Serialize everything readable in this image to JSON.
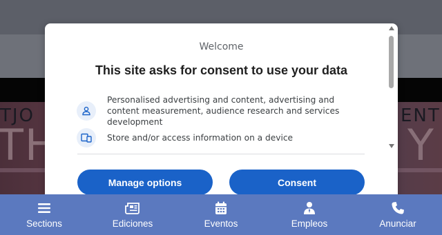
{
  "background": {
    "hero_left_small": "TJO",
    "hero_left_big": "TH",
    "hero_right_small": "ENT",
    "hero_right_big": "Y"
  },
  "dialog": {
    "brand": "Welcome",
    "title": "This site asks for consent to use your data",
    "purposes": [
      {
        "icon": "person-icon",
        "text": "Personalised advertising and content, advertising and content measurement, audience research and services development"
      },
      {
        "icon": "devices-icon",
        "text": "Store and/or access information on a device"
      }
    ],
    "manage_label": "Manage options",
    "consent_label": "Consent",
    "colors": {
      "button": "#1a62c8",
      "icon_bg": "#e8effa"
    }
  },
  "nav": {
    "items": [
      {
        "label": "Sections",
        "icon": "menu-icon"
      },
      {
        "label": "Ediciones",
        "icon": "newspaper-icon"
      },
      {
        "label": "Eventos",
        "icon": "calendar-icon"
      },
      {
        "label": "Empleos",
        "icon": "job-icon"
      },
      {
        "label": "Anunciar",
        "icon": "phone-icon"
      }
    ],
    "color": "#5b79bf"
  }
}
